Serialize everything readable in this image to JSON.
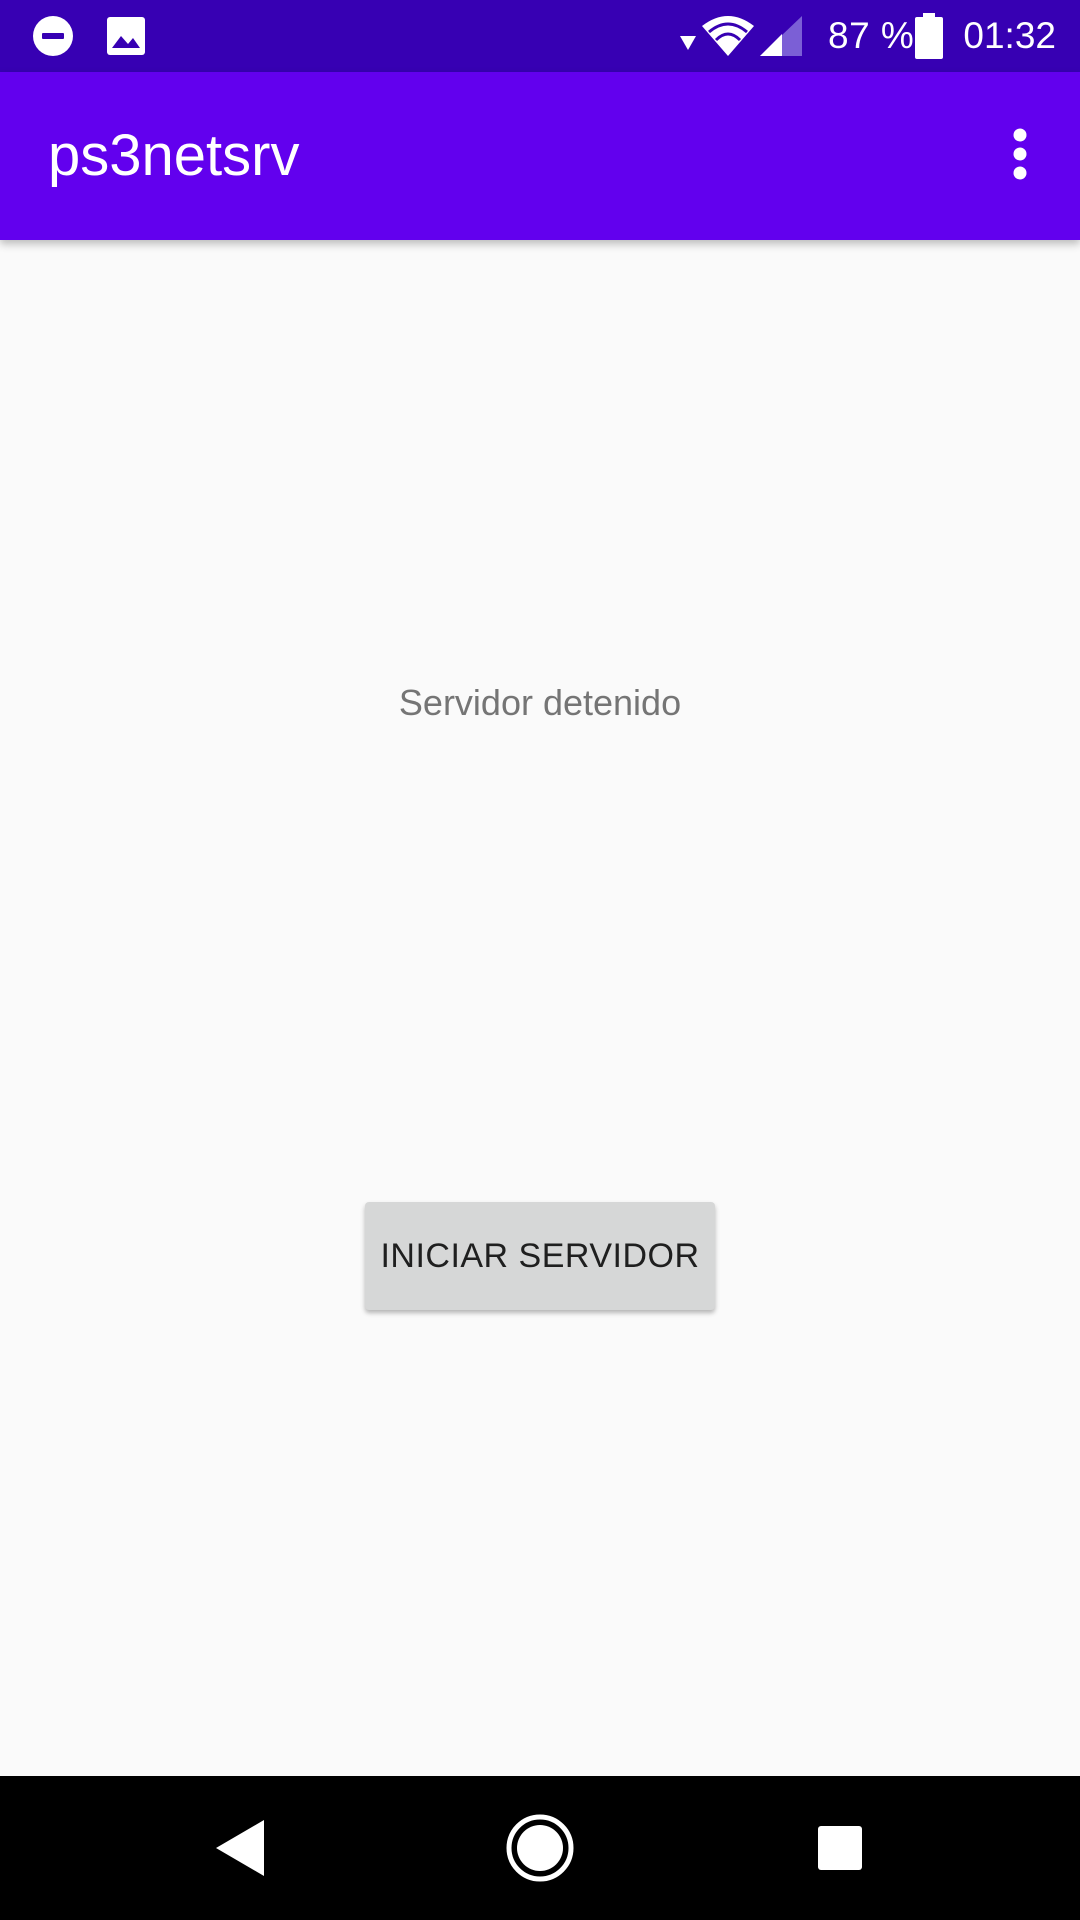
{
  "status_bar": {
    "battery_percent": "87 %",
    "time": "01:32",
    "icons": [
      "do-not-disturb-icon",
      "image-notification-icon",
      "data-arrow-icon",
      "wifi-icon",
      "cell-signal-icon",
      "battery-icon"
    ],
    "background_color": "#3700b3"
  },
  "app_bar": {
    "title": "ps3netsrv",
    "menu_icon": "more-vert-icon",
    "background_color": "#6200ee"
  },
  "main": {
    "status_text": "Servidor detenido",
    "start_button_label": "INICIAR SERVIDOR"
  },
  "nav_bar": {
    "icons": [
      "back-icon",
      "home-icon",
      "recents-icon"
    ]
  }
}
